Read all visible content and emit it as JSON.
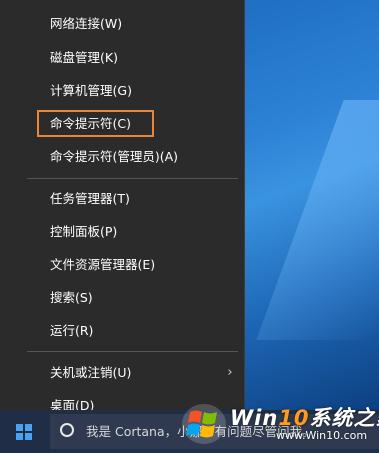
{
  "menu": {
    "items": [
      {
        "label": "网络连接(W)"
      },
      {
        "label": "磁盘管理(K)"
      },
      {
        "label": "计算机管理(G)"
      },
      {
        "label": "命令提示符(C)"
      },
      {
        "label": "命令提示符(管理员)(A)"
      },
      {
        "label": "任务管理器(T)"
      },
      {
        "label": "控制面板(P)"
      },
      {
        "label": "文件资源管理器(E)"
      },
      {
        "label": "搜索(S)"
      },
      {
        "label": "运行(R)"
      },
      {
        "label": "关机或注销(U)"
      },
      {
        "label": "桌面(D)"
      }
    ],
    "submenu_arrow_icon": "chevron-right-icon",
    "highlighted_item": "命令提示符(C)",
    "highlight_color": "#e8873a"
  },
  "taskbar": {
    "start_icon": "windows-logo-icon",
    "search": {
      "icon": "cortana-circle-icon",
      "placeholder": "我是 Cortana，小娜。有问题尽管问我。"
    }
  },
  "watermark": {
    "title_win": "Win",
    "title_ten": "10",
    "title_rest": "系统之家",
    "url": "www.Win10.com",
    "logo_icon": "windows-flag-logo-icon"
  },
  "colors": {
    "menu_background": "#2b2b2b",
    "taskbar_background": "#1f2d46",
    "accent_blue": "#4aa3f0"
  }
}
